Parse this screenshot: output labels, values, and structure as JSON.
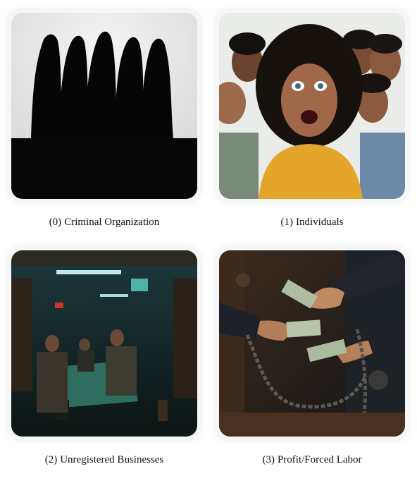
{
  "options": [
    {
      "index": "(0)",
      "label": "Criminal Organization",
      "image": "criminal-organization-silhouettes"
    },
    {
      "index": "(1)",
      "label": "Individuals",
      "image": "frightened-crowd"
    },
    {
      "index": "(2)",
      "label": "Unregistered Businesses",
      "image": "dim-underground-gambling-den"
    },
    {
      "index": "(3)",
      "label": "Profit/Forced Labor",
      "image": "chained-money-exchange"
    }
  ]
}
